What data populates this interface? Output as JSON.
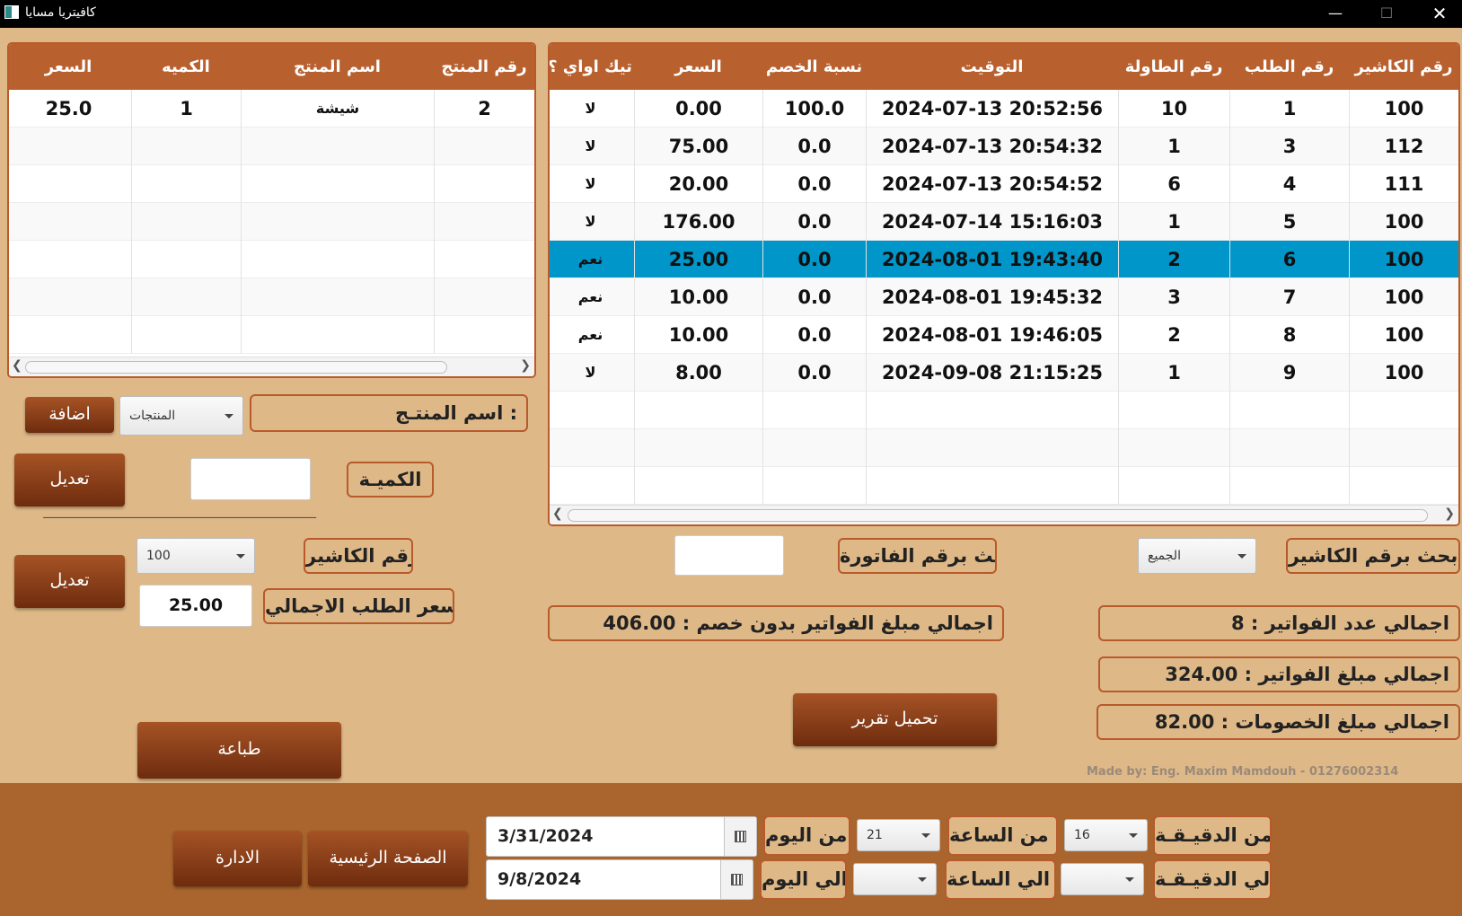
{
  "window": {
    "title": "كافيتريا مسايا"
  },
  "orders_table": {
    "headers": [
      "رقم الكاشير",
      "رقم الطلب",
      "رقم الطاولة",
      "التوقيت",
      "نسبة الخصم",
      "السعر",
      "تيك اواي ؟"
    ],
    "rows": [
      [
        "100",
        "1",
        "10",
        "2024-07-13 20:52:56",
        "100.0",
        "0.00",
        "لا"
      ],
      [
        "112",
        "3",
        "1",
        "2024-07-13 20:54:32",
        "0.0",
        "75.00",
        "لا"
      ],
      [
        "111",
        "4",
        "6",
        "2024-07-13 20:54:52",
        "0.0",
        "20.00",
        "لا"
      ],
      [
        "100",
        "5",
        "1",
        "2024-07-14 15:16:03",
        "0.0",
        "176.00",
        "لا"
      ],
      [
        "100",
        "6",
        "2",
        "2024-08-01 19:43:40",
        "0.0",
        "25.00",
        "نعم"
      ],
      [
        "100",
        "7",
        "3",
        "2024-08-01 19:45:32",
        "0.0",
        "10.00",
        "نعم"
      ],
      [
        "100",
        "8",
        "2",
        "2024-08-01 19:46:05",
        "0.0",
        "10.00",
        "نعم"
      ],
      [
        "100",
        "9",
        "1",
        "2024-09-08 21:15:25",
        "0.0",
        "8.00",
        "لا"
      ]
    ],
    "selected_row": 4
  },
  "items_table": {
    "headers": [
      "رقم المنتج",
      "اسم المنتج",
      "الكميه",
      "السعر"
    ],
    "rows": [
      [
        "2",
        "شيشة",
        "1",
        "25.0"
      ]
    ]
  },
  "left_panel": {
    "product_name_label": "اسم المنتـج :",
    "products_combo": "المنتجات",
    "add_button": "اضافة",
    "quantity_label": "الكميـة",
    "quantity_value": "",
    "edit_button": "تعديل",
    "divider": "______________________________________",
    "cashier_label": "رقم الكاشير",
    "cashier_combo": "100",
    "edit_button_2": "تعديل",
    "order_total_label": "سعر الطلب الاجمالي",
    "order_total_value": "25.00",
    "print_button": "طباعة"
  },
  "right_panel": {
    "search_cashier_label": "بحث برقم الكاشير",
    "cashier_filter": "الجميع",
    "search_invoice_label": "بحث برقم الفاتورة",
    "invoice_search_value": "",
    "total_invoice_count": "اجمالي عدد الفواتير : 8",
    "total_no_discount": "اجمالي مبلغ الفواتير بدون خصم : 406.00",
    "total_invoices_amount": "اجمالي مبلغ الفواتير : 324.00",
    "total_discounts": "اجمالي مبلغ الخصومات : 82.00",
    "load_report_button": "تحميل تقرير"
  },
  "credit": "Made by: Eng. Maxim Mamdouh - 01276002314",
  "footer": {
    "from_minute_label": "من الدقيـقـة :",
    "from_minute_value": "16",
    "from_hour_label": "من الساعة :",
    "from_hour_value": "21",
    "from_day_label": "من اليوم :",
    "from_date": "3/31/2024",
    "to_minute_label": "الي الدقيـقـة :",
    "to_minute_value": "",
    "to_hour_label": "الي الساعة :",
    "to_hour_value": "",
    "to_day_label": "الي اليوم :",
    "to_date": "9/8/2024",
    "home_button": "الصفحة الرئيسية",
    "admin_button": "الادارة"
  },
  "colors": {
    "background": "#DFB887",
    "header_brown": "#B9602F",
    "selected_row": "#0096C9",
    "footer": "#A9652D"
  }
}
